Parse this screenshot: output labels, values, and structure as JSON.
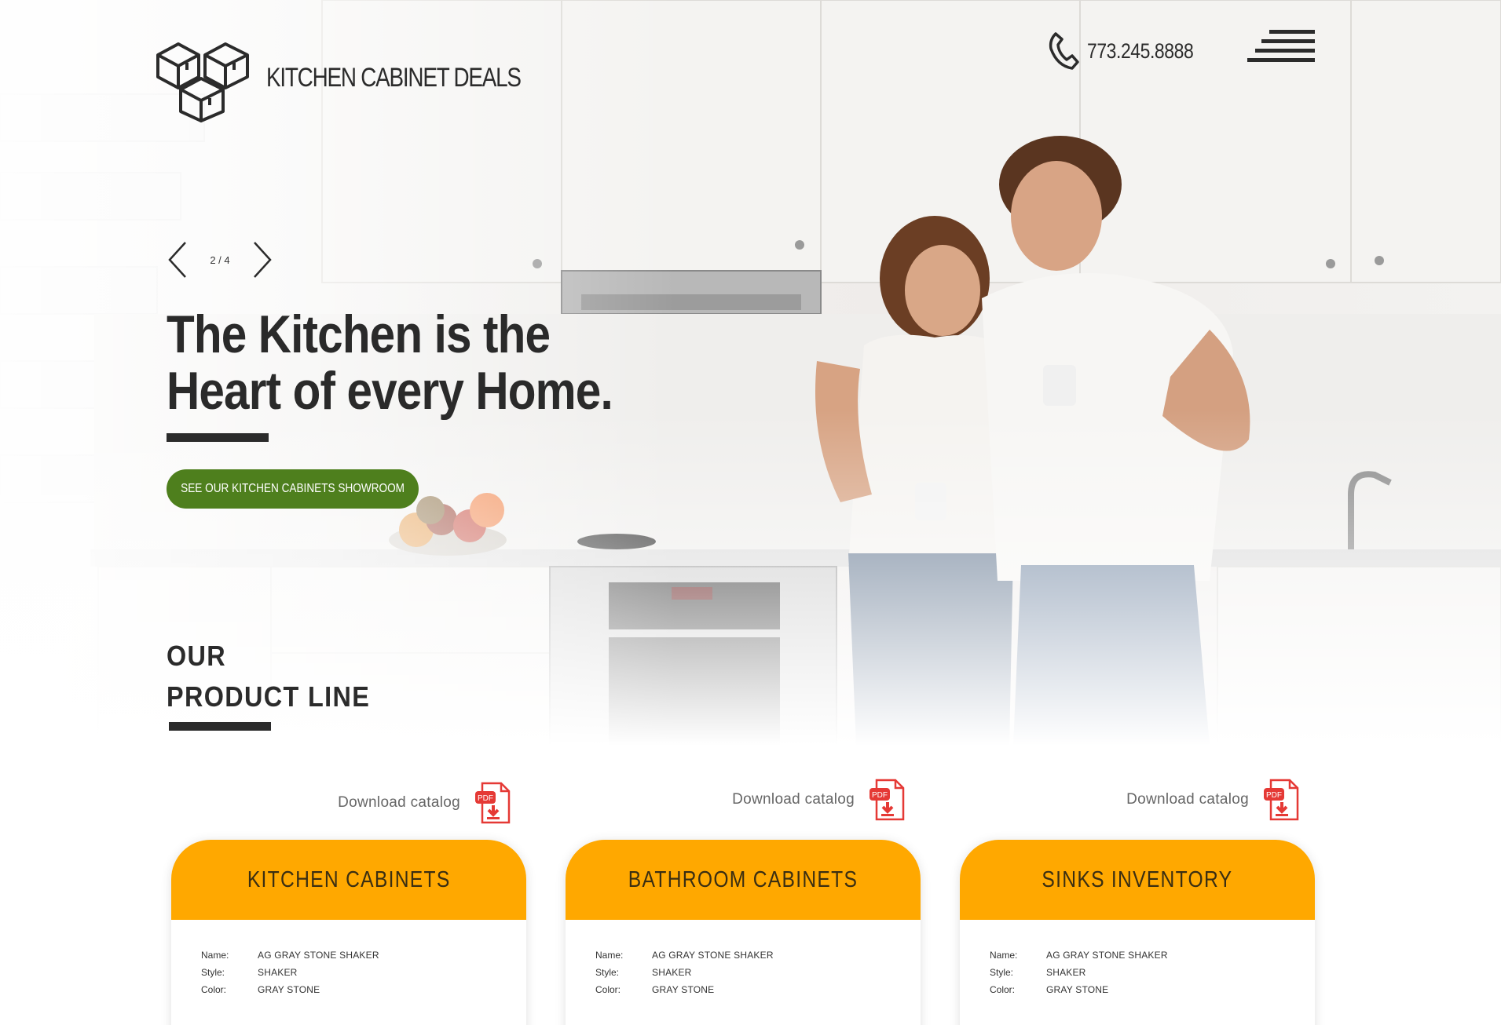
{
  "brand": {
    "name": "KITCHEN CABINET DEALS"
  },
  "header": {
    "phone": "773.245.8888"
  },
  "slider": {
    "counter": "2 / 4"
  },
  "hero": {
    "title_line1": "The Kitchen is the",
    "title_line2": "Heart of every Home.",
    "cta_label": "SEE OUR KITCHEN CABINETS SHOWROOM"
  },
  "section": {
    "title_line1": "OUR",
    "title_line2": "PRODUCT LINE"
  },
  "products": [
    {
      "download_label": "Download catalog",
      "title": "KITCHEN CABINETS",
      "name_label": "Name:",
      "name": "AG GRAY STONE SHAKER",
      "style_label": "Style:",
      "style": "SHAKER",
      "color_label": "Color:",
      "color": "GRAY STONE"
    },
    {
      "download_label": "Download catalog",
      "title": "BATHROOM CABINETS",
      "name_label": "Name:",
      "name": "AG GRAY STONE SHAKER",
      "style_label": "Style:",
      "style": "SHAKER",
      "color_label": "Color:",
      "color": "GRAY STONE"
    },
    {
      "download_label": "Download catalog",
      "title": "SINKS INVENTORY",
      "name_label": "Name:",
      "name": "AG GRAY STONE SHAKER",
      "style_label": "Style:",
      "style": "SHAKER",
      "color_label": "Color:",
      "color": "GRAY STONE"
    }
  ],
  "icons": {
    "logo": "cubes-logo-icon",
    "phone": "phone-icon",
    "menu": "hamburger-menu-icon",
    "prev": "chevron-left-icon",
    "next": "chevron-right-icon",
    "pdf": "pdf-download-icon"
  },
  "colors": {
    "cta": "#4e7f1d",
    "card_header": "#ffa800",
    "pdf_red": "#e53935",
    "dark": "#2b2b2b"
  }
}
